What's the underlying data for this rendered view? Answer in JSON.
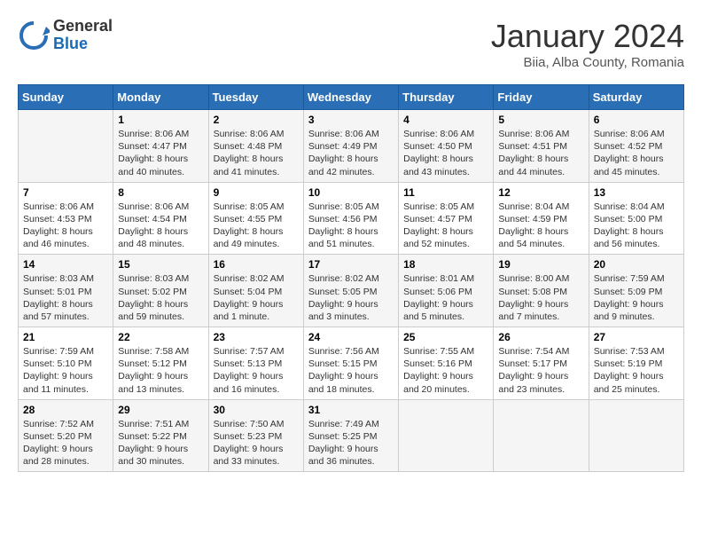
{
  "header": {
    "logo_general": "General",
    "logo_blue": "Blue",
    "month_title": "January 2024",
    "subtitle": "Biia, Alba County, Romania"
  },
  "weekdays": [
    "Sunday",
    "Monday",
    "Tuesday",
    "Wednesday",
    "Thursday",
    "Friday",
    "Saturday"
  ],
  "weeks": [
    [
      {
        "day": "",
        "content": ""
      },
      {
        "day": "1",
        "content": "Sunrise: 8:06 AM\nSunset: 4:47 PM\nDaylight: 8 hours\nand 40 minutes."
      },
      {
        "day": "2",
        "content": "Sunrise: 8:06 AM\nSunset: 4:48 PM\nDaylight: 8 hours\nand 41 minutes."
      },
      {
        "day": "3",
        "content": "Sunrise: 8:06 AM\nSunset: 4:49 PM\nDaylight: 8 hours\nand 42 minutes."
      },
      {
        "day": "4",
        "content": "Sunrise: 8:06 AM\nSunset: 4:50 PM\nDaylight: 8 hours\nand 43 minutes."
      },
      {
        "day": "5",
        "content": "Sunrise: 8:06 AM\nSunset: 4:51 PM\nDaylight: 8 hours\nand 44 minutes."
      },
      {
        "day": "6",
        "content": "Sunrise: 8:06 AM\nSunset: 4:52 PM\nDaylight: 8 hours\nand 45 minutes."
      }
    ],
    [
      {
        "day": "7",
        "content": "Sunrise: 8:06 AM\nSunset: 4:53 PM\nDaylight: 8 hours\nand 46 minutes."
      },
      {
        "day": "8",
        "content": "Sunrise: 8:06 AM\nSunset: 4:54 PM\nDaylight: 8 hours\nand 48 minutes."
      },
      {
        "day": "9",
        "content": "Sunrise: 8:05 AM\nSunset: 4:55 PM\nDaylight: 8 hours\nand 49 minutes."
      },
      {
        "day": "10",
        "content": "Sunrise: 8:05 AM\nSunset: 4:56 PM\nDaylight: 8 hours\nand 51 minutes."
      },
      {
        "day": "11",
        "content": "Sunrise: 8:05 AM\nSunset: 4:57 PM\nDaylight: 8 hours\nand 52 minutes."
      },
      {
        "day": "12",
        "content": "Sunrise: 8:04 AM\nSunset: 4:59 PM\nDaylight: 8 hours\nand 54 minutes."
      },
      {
        "day": "13",
        "content": "Sunrise: 8:04 AM\nSunset: 5:00 PM\nDaylight: 8 hours\nand 56 minutes."
      }
    ],
    [
      {
        "day": "14",
        "content": "Sunrise: 8:03 AM\nSunset: 5:01 PM\nDaylight: 8 hours\nand 57 minutes."
      },
      {
        "day": "15",
        "content": "Sunrise: 8:03 AM\nSunset: 5:02 PM\nDaylight: 8 hours\nand 59 minutes."
      },
      {
        "day": "16",
        "content": "Sunrise: 8:02 AM\nSunset: 5:04 PM\nDaylight: 9 hours\nand 1 minute."
      },
      {
        "day": "17",
        "content": "Sunrise: 8:02 AM\nSunset: 5:05 PM\nDaylight: 9 hours\nand 3 minutes."
      },
      {
        "day": "18",
        "content": "Sunrise: 8:01 AM\nSunset: 5:06 PM\nDaylight: 9 hours\nand 5 minutes."
      },
      {
        "day": "19",
        "content": "Sunrise: 8:00 AM\nSunset: 5:08 PM\nDaylight: 9 hours\nand 7 minutes."
      },
      {
        "day": "20",
        "content": "Sunrise: 7:59 AM\nSunset: 5:09 PM\nDaylight: 9 hours\nand 9 minutes."
      }
    ],
    [
      {
        "day": "21",
        "content": "Sunrise: 7:59 AM\nSunset: 5:10 PM\nDaylight: 9 hours\nand 11 minutes."
      },
      {
        "day": "22",
        "content": "Sunrise: 7:58 AM\nSunset: 5:12 PM\nDaylight: 9 hours\nand 13 minutes."
      },
      {
        "day": "23",
        "content": "Sunrise: 7:57 AM\nSunset: 5:13 PM\nDaylight: 9 hours\nand 16 minutes."
      },
      {
        "day": "24",
        "content": "Sunrise: 7:56 AM\nSunset: 5:15 PM\nDaylight: 9 hours\nand 18 minutes."
      },
      {
        "day": "25",
        "content": "Sunrise: 7:55 AM\nSunset: 5:16 PM\nDaylight: 9 hours\nand 20 minutes."
      },
      {
        "day": "26",
        "content": "Sunrise: 7:54 AM\nSunset: 5:17 PM\nDaylight: 9 hours\nand 23 minutes."
      },
      {
        "day": "27",
        "content": "Sunrise: 7:53 AM\nSunset: 5:19 PM\nDaylight: 9 hours\nand 25 minutes."
      }
    ],
    [
      {
        "day": "28",
        "content": "Sunrise: 7:52 AM\nSunset: 5:20 PM\nDaylight: 9 hours\nand 28 minutes."
      },
      {
        "day": "29",
        "content": "Sunrise: 7:51 AM\nSunset: 5:22 PM\nDaylight: 9 hours\nand 30 minutes."
      },
      {
        "day": "30",
        "content": "Sunrise: 7:50 AM\nSunset: 5:23 PM\nDaylight: 9 hours\nand 33 minutes."
      },
      {
        "day": "31",
        "content": "Sunrise: 7:49 AM\nSunset: 5:25 PM\nDaylight: 9 hours\nand 36 minutes."
      },
      {
        "day": "",
        "content": ""
      },
      {
        "day": "",
        "content": ""
      },
      {
        "day": "",
        "content": ""
      }
    ]
  ]
}
